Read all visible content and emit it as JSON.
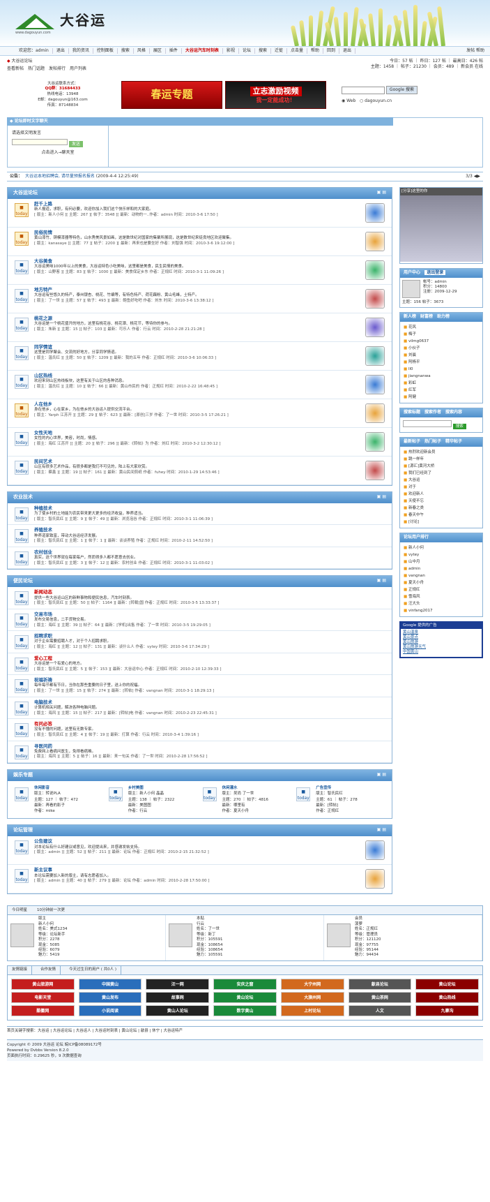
{
  "header": {
    "site_name": "大谷运",
    "url": "www.dagouyun.com"
  },
  "nav": {
    "items": [
      "欢迎您：admin",
      "退出",
      "我的资讯",
      "控制面板",
      "搜索",
      "风格",
      "展区",
      "插件",
      "大谷运汽车时刻表",
      "影视",
      "论坛",
      "搜索",
      "迁徙",
      "点击量",
      "帮助",
      "回到",
      "退出"
    ],
    "right": "发帖 帮助"
  },
  "sub": {
    "crumb": "大谷运论坛",
    "links": [
      "查看新帖",
      "热门话题",
      "发帖排行",
      "用户列表"
    ],
    "stats1": "今日：57 帖 ｜ 昨日：127 帖 ｜ 最高日：426 帖",
    "stats2": "主题：1458 ｜ 帖子：21230 ｜ 会员：489 ｜ 新会员 在线"
  },
  "ads": {
    "text1": "大谷运联系方式：",
    "text2": "QQ群：31684433",
    "text3": "热线电话：13948",
    "text4": "E邮：dagouyun@163.com",
    "text5": "传真：87148834",
    "b1": "春运专题",
    "b2a": "立志激励视频",
    "b2b": "我一定能成功！",
    "search_btn": "Google 搜索",
    "r1": "Web",
    "r2": "dagouyun.cn"
  },
  "chat": {
    "title": "论坛即时文字聊天",
    "login": "请选择文明发言",
    "enter": "点击进入→聊天室"
  },
  "announce": {
    "label": "公告：",
    "text": "大谷运本地招聘会, 请尽量预报名报名",
    "date": "(2009-4-4 12:25:49)",
    "page": "3/3"
  },
  "sec1": {
    "title": "大谷运论坛",
    "rows": [
      {
        "name": "赶千上路",
        "desc": "新人报道，求职，有何必要，欢迎你加入我们这个快乐祥和的大家庭。",
        "meta": "[ 版主：新人小何 ][ 主题：267 ][ 帖子：3548 ][ 最新：动物的一..作者：admin 时间：2010-3-6 17:50 ]",
        "hot": true
      },
      {
        "name": "民俗民情",
        "desc": "黄山漆竹、铜模漆器等特色，山水秀美风景如画，这是数世纪对国家的集聚所展现，这是数世纪来徒良地区欢迎聚集。",
        "meta": "[ 版主：kanasaye ][ 主题：77 ][ 帖子：2200 ][ 最新：再来也是要坐好 作者：刘智强 时间：2010-3-6 19:12:00 ]",
        "hot": true
      },
      {
        "name": "大谷美食",
        "desc": "大谷运美味1000年以上的美食，大谷运特色小吃美味，这里都是美食，民生民情的美食。",
        "meta": "[ 版主：山野客 ][ 主题：83 ][ 帖子：1000 ][ 最新：美食保定乡东 作者：正规红 时间：2010-3-1 11:09:26 ]",
        "hot": false
      },
      {
        "name": "地方特产",
        "desc": "大谷运有些悠久的特产，泰州银杏、桃花、竹编等，有特色特产、荷花藕粉、黄山毛峰，土特产。",
        "meta": "[ 版主：了一世 ][ 主题：57 ][ 帖子：493 ][ 最新：鲍鱼好吃吧 作者：刘东 时间：2010-3-6 13:38:12 ]",
        "hot": false
      },
      {
        "name": "桃花之源",
        "desc": "大谷运是一个桃花盛开的地方，这里有桃花谷、桃花潭、桃花节，等待你的参与。",
        "meta": "[ 版主：朱新 ][ 主题：15 ][ 帖子：103 ][ 最新：可乐人 作者：行云 时间：2010-2-28 21:21:28 ]",
        "hot": false
      },
      {
        "name": "同学情谊",
        "desc": "这里是同学聚会、交流的好地方，分享同学情谊。",
        "meta": "[ 版主：温氏红 ][ 主题：50 ][ 帖子：1209 ][ 最新：我的五年 作者：正规红 时间：2010-3-6 10:06:33 ]",
        "hot": false
      },
      {
        "name": "山区热线",
        "desc": "欢迎来到山区热线板块，这里有关于山区的各种消息。",
        "meta": "[ 版主：温氏红 ][ 主题：10 ][ 帖子：66 ][ 最新：黄山市民的 作者：正规红 时间：2010-2-22 16:48:45 ]",
        "hot": false
      },
      {
        "name": "人在他乡",
        "desc": "身在他乡，心在家乡，为在他乡的大谷运人提供交流平台。",
        "meta": "[ 版主：Yarph 江苏开 ][ 主题：29 ][ 帖子：623 ][ 最新：[原创]三岁 作者：了一世 时间：2010-3-5 17:26:21 ]",
        "hot": true
      },
      {
        "name": "女性天地",
        "desc": "女性的内心世界，美容，时尚，情感。",
        "meta": "[ 版主：海红 江苏开 ][ 主题：20 ][ 帖子：296 ][ 最新：《转帖》为 作者：刘红 时间：2010-3-2 12:30:12 ]",
        "hot": false
      },
      {
        "name": "民间艺术",
        "desc": "山区有很多艺术作品，有很多都是我们不可见的，陆上有大家欣赏。",
        "meta": "[ 版主：蔡鑫 ][ 主题：19 ][ 帖子：161 ][ 最新：黄山民间剪纸 作者：fuhey 时间：2010-1-29 14:53:46 ]",
        "hot": false
      }
    ]
  },
  "sec2": {
    "title": "农业技术",
    "rows": [
      {
        "name": "种植技术",
        "desc": "为了使乡村的土地能为农民带来更大更多的经济收益，种养适当。",
        "meta": "[ 版主：智氏民红 ][ 主题：9 ][ 帖子：49 ][ 最新：浏览泡谷 作者：正规红 时间：2010-3-1 11:06:39 ]"
      },
      {
        "name": "养殖技术",
        "desc": "种养道家致富，带动大谷运经济发展。",
        "meta": "[ 版主：智氏民红 ][ 主题：1 ][ 帖子：1 ][ 最新：谈谈养殖 作者：正规红 时间：2010-2-11 14:52:50 ]"
      },
      {
        "name": "农村创业",
        "desc": "真实，这个世界就在每家每户，然而得多人都不愿意去创业。",
        "meta": "[ 版主：智氏民红 ][ 主题：3 ][ 帖子：12 ][ 最新：农村创业 作者：正规红 时间：2010-3-1 11:03:02 ]"
      }
    ]
  },
  "sec3": {
    "title": "便民论坛",
    "rows": [
      {
        "name": "新闻动态",
        "desc": "提供一些大谷运山区的新鲜事物和便民信息，汽车时刻表。",
        "meta": "[ 版主：智氏民红 ][ 主题：50 ][ 帖子：1164 ][ 最新：[转载]国 作者：正规红 时间：2010-3-5 13:33:37 ]",
        "r": true
      },
      {
        "name": "交易市场",
        "desc": "发布交易信息，二手货物交易。",
        "meta": "[ 版主：海红 ][ 主题：39 ][ 帖子：64 ][ 最新：[学机]出售 作者：了一世 时间：2010-3-5 19:29:05 ]",
        "r": false
      },
      {
        "name": "招聘求职",
        "desc": "对于企业需要招聘人才，对于个人招聘求职。",
        "meta": "[ 版主：海红 ][ 主题：12 ][ 帖子：131 ][ 最新：谈什么人 作者：vytey 时间：2010-3-6 17:34:29 ]",
        "r": false
      },
      {
        "name": "爱心工程",
        "desc": "大谷运是一个有爱心的地方。",
        "meta": "[ 版主：智氏民红 ][ 主题：5 ][ 帖子：153 ][ 最新：大谷运中心 作者：正规红 时间：2010-2-10 12:39:33 ]",
        "r": true
      },
      {
        "name": "祝福祈祷",
        "desc": "每年每节都有节日，当你在那些重要的日子里，送上你的祝福。",
        "meta": "[ 版主：了一世 ][ 主题：15 ][ 帖子：274 ][ 最新：[转帖] 作者：vangnan 时间：2010-3-1 18:29:13 ]",
        "r": false
      },
      {
        "name": "电脑技术",
        "desc": "计算机相关问题，解决各种电脑问题。",
        "meta": "[ 版主：海风 ][ 主题：15 ][ 帖子：217 ][ 最新：[转帖]电 作者：vangnan 时间：2010-2-23 22:45:31 ]",
        "r": false
      },
      {
        "name": "有问必答",
        "desc": "没有不懂的问题，这里有无数专家。",
        "meta": "[ 版主：智氏民红 ][ 主题：4 ][ 帖子：19 ][ 最新：打算 作者：行云 时间：2010-3-4 1:39:16 ]",
        "r": true
      },
      {
        "name": "寻医问药",
        "desc": "免费网上看病问医生，免得看病难。",
        "meta": "[ 版主：海风 ][ 主题：5 ][ 帖子：16 ][ 最新：来一句关 作者：了一世 时间：2010-2-28 17:56:52 ]",
        "r": false
      }
    ]
  },
  "sec4": {
    "title": "娱乐专题",
    "cells": [
      {
        "name": "休闲影音",
        "l1": "版主：转说PLA",
        "l2": "主题：127 ｜ 帖子：472",
        "l3": "最新：再看的影子",
        "l4": "作者：mike"
      },
      {
        "name": "乡村美图",
        "l1": "版主：新人小何 晶晶",
        "l2": "主题：138 ｜ 帖子：2322",
        "l3": "最新：美图图",
        "l4": "作者：行云"
      },
      {
        "name": "休闲灌水",
        "l1": "版主：吴尚 了一世",
        "l2": "主题：270 ｜ 帖子：4816",
        "l3": "最新：哪里有",
        "l4": "作者：夏天小舟"
      },
      {
        "name": "广告宣传",
        "l1": "版主：智氏民红",
        "l2": "主题：61 ｜ 帖子：278",
        "l3": "最新：[转帖]",
        "l4": "作者：正规红"
      }
    ]
  },
  "sec5": {
    "title": "论坛管理",
    "rows": [
      {
        "name": "公告建议",
        "desc": "对本论坛有什么好建议或意见，欢迎提出来，并感谢发帖支持。",
        "meta": "[ 版主：admin ][ 主题：52 ][ 帖子：211 ][ 最新：论坛 作者：正规红 时间：2010-2-15 21:32:52 ]"
      },
      {
        "name": "新主议事",
        "desc": "本论坛需要加入新的版主，请有志愿者加入。",
        "meta": "[ 版主：admin ][ 主题：40 ][ 帖子：279 ][ 最新：论坛 作者：admin 时间：2010-2-28 17:50:00 ]"
      }
    ]
  },
  "right": {
    "ad": "[分享]这里的你",
    "user": {
      "title": "用户中心",
      "logout": "退出登录",
      "l1": "帐号：admin",
      "l2": "积分：14800",
      "l3": "注册：2009-12-29",
      "l4": "主题：156",
      "l5": "帖子：3673"
    },
    "tabs": [
      "新人榜",
      "财富榜",
      "助力榜"
    ],
    "new_users": [
      "花风",
      "梅子",
      "vilmg0637",
      "小伙子",
      "刘晨",
      "阿杨平",
      "ll0",
      "jiangnanwa",
      "彩虹",
      "红军",
      "阿健"
    ],
    "search": {
      "tabs": [
        "搜索标题",
        "搜索作者",
        "搜索内容"
      ],
      "btn": "搜索"
    },
    "hot": {
      "tabs": [
        "最新帖子",
        "热门帖子",
        "精华帖子"
      ],
      "items": [
        "热烈欢迎新会员",
        "跳一样年",
        "[源汇]黄河大桥",
        "我们已经到了",
        "大谷运",
        "对于",
        "欢迎新人",
        "天使不忘",
        "新春之类",
        "春天中午",
        "[讨论]"
      ]
    },
    "rank": {
      "title": "论坛用户排行",
      "items": [
        "新人小何",
        "vytey",
        "山中月",
        "admin",
        "vangnan",
        "夏天小舟",
        "正规红",
        "雪海风",
        "汪大头",
        "vinfang2017"
      ]
    },
    "google": {
      "title": "Google 提供的广告",
      "items": [
        "黄山温泉",
        "黄山景点",
        "黄山旅游",
        "黄山旅游天气",
        "中国黄山"
      ]
    }
  },
  "footer": {
    "bar": [
      "今日明星",
      "10分钟前一次更"
    ],
    "people": [
      {
        "tag": "版主",
        "name": "新人小何",
        "l1": "姓名：美式1234",
        "l2": "等级：论坛新手",
        "l3": "积分：2278",
        "l4": "现金：5085",
        "l5": "经验：6079",
        "l6": "魅力：5419"
      },
      {
        "tag": "本贴",
        "name": "行云",
        "l1": "姓名：了一世",
        "l2": "等级：新丁",
        "l3": "积分：105591",
        "l4": "现金：108654",
        "l5": "经验：108654",
        "l6": "魅力：105591"
      },
      {
        "tag": "会员",
        "name": "菠萝",
        "l1": "姓名：正规红",
        "l2": "等级：管理员",
        "l3": "积分：121120",
        "l4": "现金：97755",
        "l5": "经验：95144",
        "l6": "魅力：94434"
      }
    ],
    "link_tabs": [
      "友情链接",
      "合作友情",
      "今天过生日的用户 ( 共0人 )"
    ],
    "links": [
      "黄山旅游网",
      "中国黄山",
      "汪一网",
      "安庆之窗",
      "大宁州网",
      "歙县论坛",
      "黄山论坛",
      "电影天堂",
      "黄山发布",
      "故事网",
      "黄山论坛",
      "大旗州网",
      "黄山茶网",
      "黄山热线",
      "酷徽网",
      "小说阅读",
      "黄山人论坛",
      "数字黄山",
      "上村论坛",
      "人文",
      "九寨沟"
    ],
    "kw": "首页关键字搜索：大谷运 | 大谷运论坛 | 大谷运人 | 大谷运时刻表 | 黄山论坛 | 歙县 | 休宁 | 大谷运特产",
    "cp1": "Copyright © 2009 大谷运 论坛 皖ICP备08089172号",
    "cp2": "Powered by Dvbbs Version 8.2.0",
    "cp3": "页面执行时间：0.29625 秒，9 次数据查询"
  }
}
